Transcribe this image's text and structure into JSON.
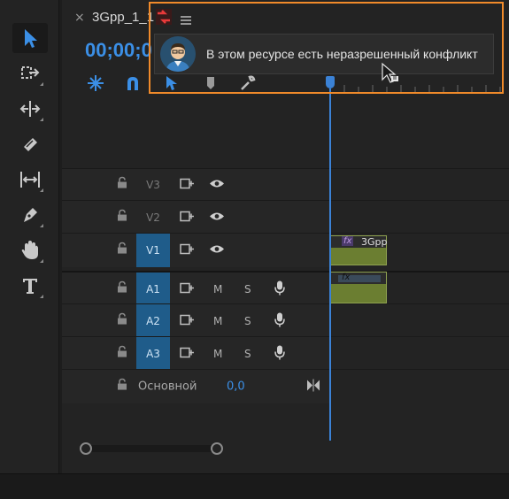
{
  "tab": {
    "close": "×",
    "title": "3Gpp_1_1"
  },
  "timecode": "00;00;0",
  "tooltip": {
    "message": "В этом ресурсе есть неразрешенный конфликт"
  },
  "tracks": [
    {
      "label": "V3",
      "active": false,
      "type": "video"
    },
    {
      "label": "V2",
      "active": false,
      "type": "video"
    },
    {
      "label": "V1",
      "active": true,
      "type": "video"
    },
    {
      "label": "A1",
      "active": true,
      "type": "audio",
      "m": "M",
      "s": "S"
    },
    {
      "label": "A2",
      "active": true,
      "type": "audio",
      "m": "M",
      "s": "S"
    },
    {
      "label": "A3",
      "active": true,
      "type": "audio",
      "m": "M",
      "s": "S"
    }
  ],
  "master": {
    "label": "Основной",
    "value": "0,0"
  },
  "clip": {
    "fx": "fx",
    "name": "3Gpp"
  },
  "colors": {
    "accent": "#3b8fe6",
    "highlight": "#f08a2a",
    "track_active": "#1f5c8a",
    "clip": "#6b7e31"
  }
}
